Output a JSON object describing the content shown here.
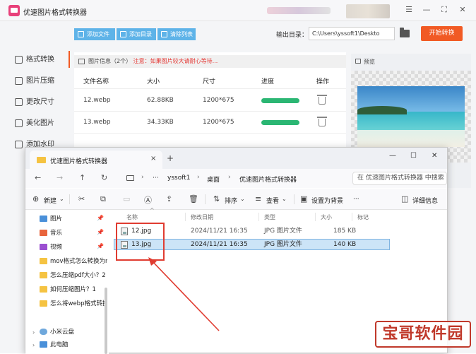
{
  "app": {
    "title": "优速图片格式转换器",
    "toolbar": {
      "add_file": "添加文件",
      "add_folder": "添加目录",
      "clear_list": "清除列表"
    },
    "output_label": "输出目录：",
    "output_path": "C:\\Users\\yssoft1\\Deskto",
    "start_button": "开始转换",
    "sidebar": [
      {
        "label": "格式转换",
        "active": true
      },
      {
        "label": "图片压缩"
      },
      {
        "label": "更改尺寸"
      },
      {
        "label": "美化图片"
      },
      {
        "label": "添加水印"
      }
    ],
    "info": {
      "title": "图片信息（2个）",
      "warning": "注意：如果图片较大请耐心等待..."
    },
    "columns": [
      "文件名称",
      "大小",
      "尺寸",
      "进度",
      "操作"
    ],
    "files": [
      {
        "name": "12.webp",
        "size": "62.88KB",
        "dims": "1200*675",
        "progress": 1.0
      },
      {
        "name": "13.webp",
        "size": "34.33KB",
        "dims": "1200*675",
        "progress": 1.0
      }
    ],
    "preview_label": "预览"
  },
  "explorer": {
    "tab_title": "优速图片格式转换器",
    "tab_close": "×",
    "new_tab": "+",
    "breadcrumb": [
      "yssoft1",
      "桌面",
      "优速图片格式转换器"
    ],
    "breadcrumb_more": "···",
    "search_placeholder": "在 优速图片格式转换器 中搜索",
    "commands": {
      "new": "新建",
      "sort": "排序",
      "view": "查看",
      "set_wallpaper": "设置为背景",
      "more": "···",
      "details": "详细信息"
    },
    "nav_items": [
      {
        "label": "图片",
        "pinned": true
      },
      {
        "label": "音乐",
        "pinned": true
      },
      {
        "label": "视频",
        "pinned": true
      },
      {
        "label": "mov格式怎么转换为n"
      },
      {
        "label": "怎么压缩pdf大小？2"
      },
      {
        "label": "如何压缩图片？1"
      },
      {
        "label": "怎么将webp格式转换"
      }
    ],
    "nav_drives": [
      {
        "label": "小米云盘"
      },
      {
        "label": "此电脑"
      }
    ],
    "file_columns": [
      "名称",
      "修改日期",
      "类型",
      "大小",
      "标记"
    ],
    "files": [
      {
        "name": "12.jpg",
        "date": "2024/11/21 16:35",
        "type": "JPG 图片文件",
        "size": "185 KB",
        "selected": false
      },
      {
        "name": "13.jpg",
        "date": "2024/11/21 16:35",
        "type": "JPG 图片文件",
        "size": "140 KB",
        "selected": true
      }
    ]
  },
  "watermark": "宝哥软件园",
  "colors": {
    "accent_blue": "#5eb3e8",
    "start_orange": "#f15a24",
    "progress_green": "#2bb673",
    "annotation_red": "#e03c31",
    "selection_blue": "#cce4f7"
  }
}
